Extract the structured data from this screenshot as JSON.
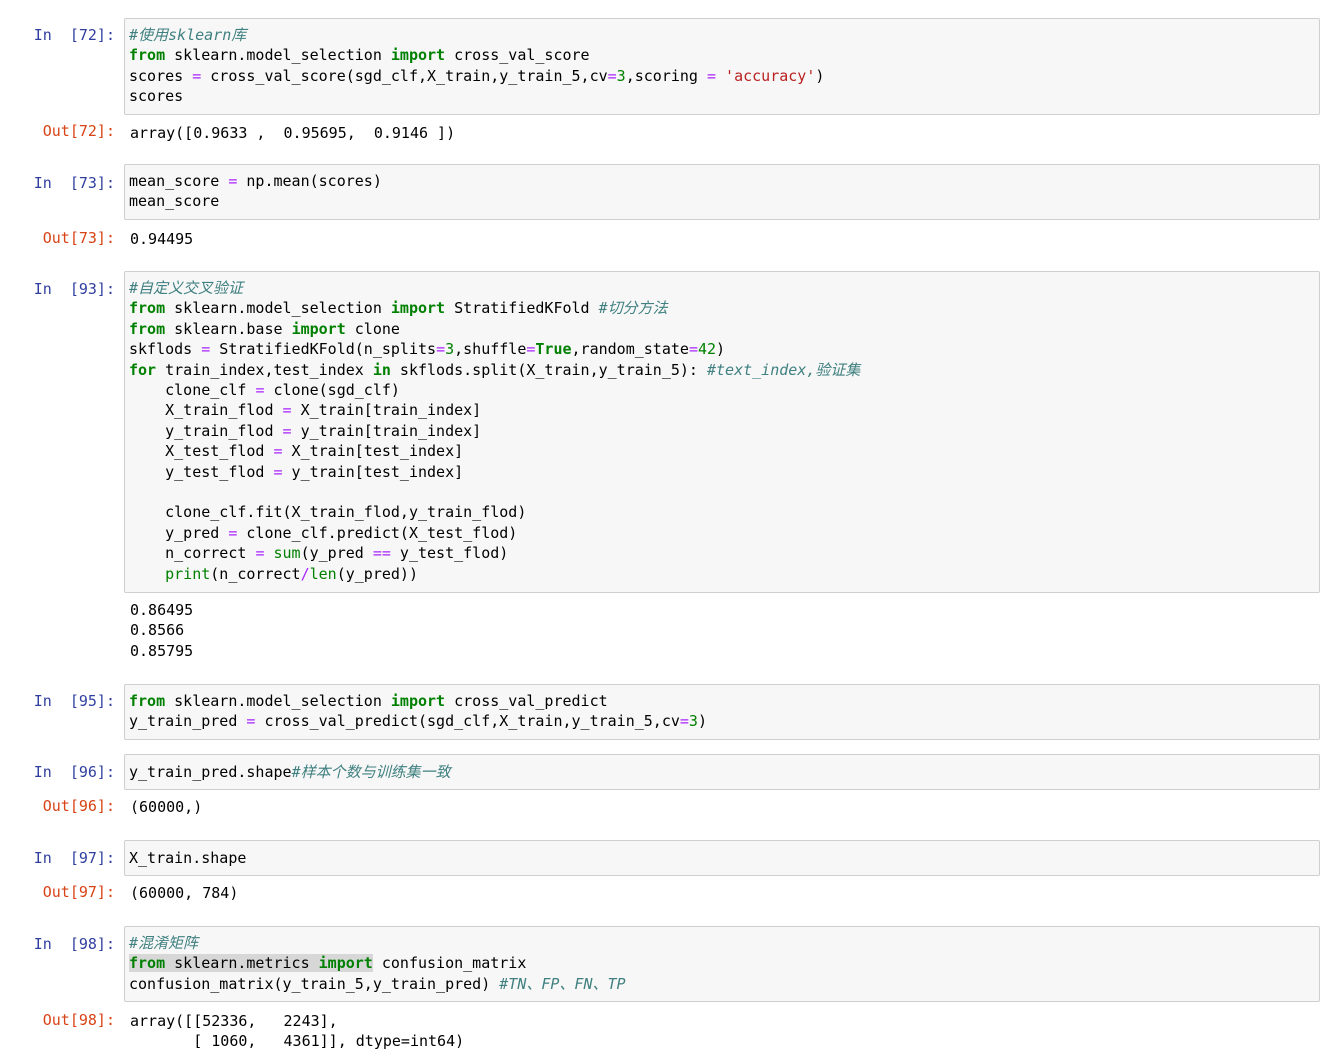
{
  "cells": [
    {
      "in_prompt": "In  [72]:",
      "out_prompt": "Out[72]:",
      "code": {
        "l1_comment": "#使用sklearn库",
        "l2_from": "from",
        "l2_module": " sklearn.model_selection ",
        "l2_import": "import",
        "l2_name": " cross_val_score",
        "l3_a": "scores ",
        "l3_eq": "=",
        "l3_b": " cross_val_score(sgd_clf,X_train,y_train_5,cv",
        "l3_eq2": "=",
        "l3_num": "3",
        "l3_c": ",scoring ",
        "l3_eq3": "=",
        "l3_str": " 'accuracy'",
        "l3_d": ")",
        "l4": "scores"
      },
      "output": "array([0.9633 ,  0.95695,  0.9146 ])"
    },
    {
      "in_prompt": "In  [73]:",
      "out_prompt": "Out[73]:",
      "code": {
        "l1_a": "mean_score ",
        "l1_eq": "=",
        "l1_b": " np.mean(scores)",
        "l2": "mean_score"
      },
      "output": "0.94495"
    },
    {
      "in_prompt": "In  [93]:",
      "code": {
        "l1_comment": "#自定义交叉验证",
        "l2_from": "from",
        "l2_module": " sklearn.model_selection ",
        "l2_import": "import",
        "l2_name": " StratifiedKFold ",
        "l2_comment": "#切分方法",
        "l3_from": "from",
        "l3_module": " sklearn.base ",
        "l3_import": "import",
        "l3_name": " clone",
        "l4_a": "skflods ",
        "l4_eq": "=",
        "l4_b": " StratifiedKFold(n_splits",
        "l4_eq2": "=",
        "l4_n1": "3",
        "l4_c": ",shuffle",
        "l4_eq3": "=",
        "l4_true": "True",
        "l4_d": ",random_state",
        "l4_eq4": "=",
        "l4_n2": "42",
        "l4_e": ")",
        "l5_for": "for",
        "l5_a": " train_index,test_index ",
        "l5_in": "in",
        "l5_b": " skflods.split(X_train,y_train_5): ",
        "l5_comment": "#text_index,验证集",
        "l6_a": "    clone_clf ",
        "l6_eq": "=",
        "l6_b": " clone(sgd_clf)",
        "l7_a": "    X_train_flod ",
        "l7_eq": "=",
        "l7_b": " X_train[train_index]",
        "l8_a": "    y_train_flod ",
        "l8_eq": "=",
        "l8_b": " y_train[train_index]",
        "l9_a": "    X_test_flod ",
        "l9_eq": "=",
        "l9_b": " X_train[test_index]",
        "l10_a": "    y_test_flod ",
        "l10_eq": "=",
        "l10_b": " y_train[test_index]",
        "l12": "    clone_clf.fit(X_train_flod,y_train_flod)",
        "l13_a": "    y_pred ",
        "l13_eq": "=",
        "l13_b": " clone_clf.predict(X_test_flod)",
        "l14_a": "    n_correct ",
        "l14_eq": "=",
        "l14_sp": " ",
        "l14_sum": "sum",
        "l14_b": "(y_pred ",
        "l14_eqeq": "==",
        "l14_c": " y_test_flod)",
        "l15_sp": "    ",
        "l15_print": "print",
        "l15_a": "(n_correct",
        "l15_div": "/",
        "l15_len": "len",
        "l15_b": "(y_pred))"
      },
      "output": "0.86495\n0.8566\n0.85795"
    },
    {
      "in_prompt": "In  [95]:",
      "code": {
        "l1_from": "from",
        "l1_module": " sklearn.model_selection ",
        "l1_import": "import",
        "l1_name": " cross_val_predict",
        "l2_a": "y_train_pred ",
        "l2_eq": "=",
        "l2_b": " cross_val_predict(sgd_clf,X_train,y_train_5,cv",
        "l2_eq2": "=",
        "l2_num": "3",
        "l2_c": ")"
      }
    },
    {
      "in_prompt": "In  [96]:",
      "out_prompt": "Out[96]:",
      "code": {
        "l1_a": "y_train_pred.shape",
        "l1_comment": "#样本个数与训练集一致"
      },
      "output": "(60000,)"
    },
    {
      "in_prompt": "In  [97]:",
      "out_prompt": "Out[97]:",
      "code": {
        "l1": "X_train.shape"
      },
      "output": "(60000, 784)"
    },
    {
      "in_prompt": "In  [98]:",
      "out_prompt": "Out[98]:",
      "code": {
        "l1_comment": "#混淆矩阵",
        "l2_from": "from",
        "l2_module": " sklearn.metrics ",
        "l2_import": "import",
        "l2_name": " confusion_matrix",
        "l3_a": "confusion_matrix(y_train_5,y_train_pred) ",
        "l3_comment": "#TN、FP、FN、TP"
      },
      "output": "array([[52336,   2243],\n       [ 1060,   4361]], dtype=int64)"
    }
  ]
}
